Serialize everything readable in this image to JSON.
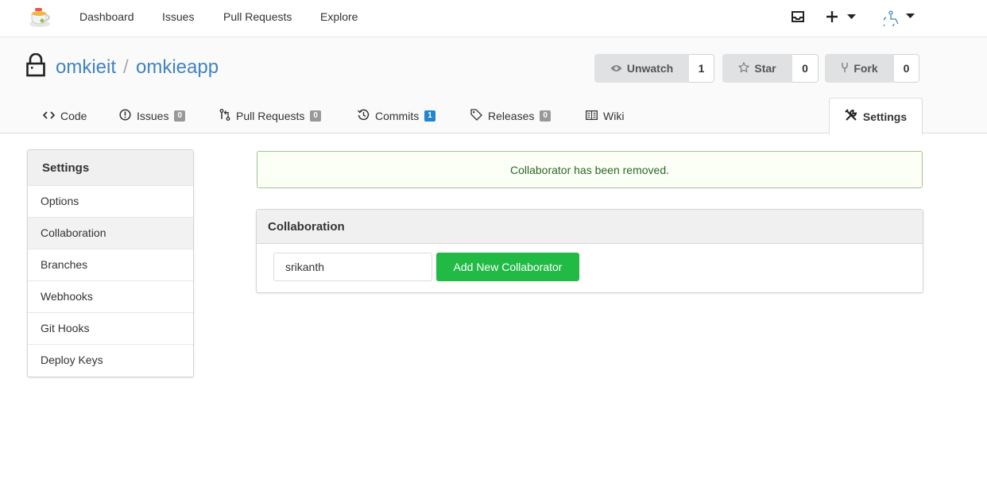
{
  "nav": {
    "items": [
      "Dashboard",
      "Issues",
      "Pull Requests",
      "Explore"
    ]
  },
  "repo": {
    "owner": "omkieit",
    "separator": "/",
    "name": "omkieapp",
    "watch": {
      "label": "Unwatch",
      "count": "1"
    },
    "star": {
      "label": "Star",
      "count": "0"
    },
    "fork": {
      "label": "Fork",
      "count": "0"
    }
  },
  "tabs": [
    {
      "label": "Code"
    },
    {
      "label": "Issues",
      "count": "0"
    },
    {
      "label": "Pull Requests",
      "count": "0"
    },
    {
      "label": "Commits",
      "count": "1"
    },
    {
      "label": "Releases",
      "count": "0"
    },
    {
      "label": "Wiki"
    },
    {
      "label": "Settings"
    }
  ],
  "sidebar": {
    "title": "Settings",
    "items": [
      {
        "label": "Options"
      },
      {
        "label": "Collaboration",
        "active": true
      },
      {
        "label": "Branches"
      },
      {
        "label": "Webhooks"
      },
      {
        "label": "Git Hooks"
      },
      {
        "label": "Deploy Keys"
      }
    ]
  },
  "flash": "Collaborator has been removed.",
  "collaboration": {
    "title": "Collaboration",
    "input_value": "srikanth",
    "add_button": "Add New Collaborator"
  },
  "colors": {
    "link": "#4183c4",
    "success_button": "#21ba45",
    "badge_blue": "#2185d0"
  }
}
